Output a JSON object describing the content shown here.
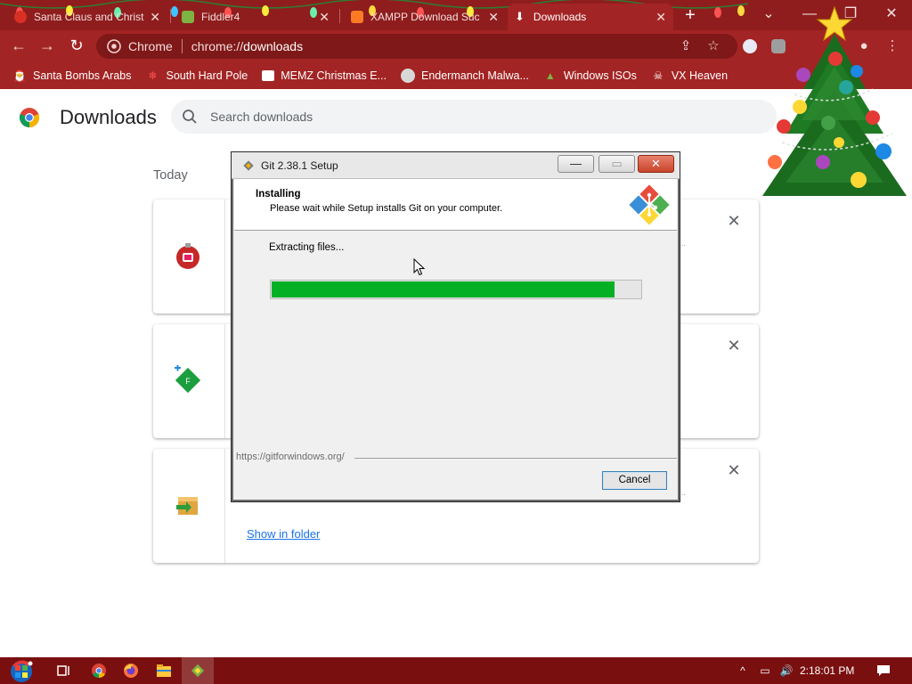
{
  "tabs": [
    {
      "title": "Santa Claus and Christ",
      "favicon_color": "#d93025",
      "active": false
    },
    {
      "title": "Fiddler4",
      "favicon_color": "#7cb342",
      "active": false
    },
    {
      "title": "XAMPP Download Suc",
      "favicon_color": "#fb7a24",
      "active": false
    },
    {
      "title": "Downloads",
      "favicon_color": "#ffffff",
      "active": true
    }
  ],
  "window_controls": {
    "minimize": "—",
    "maximize": "❐",
    "close": "✕"
  },
  "toolbar": {
    "omnibox_site": "Chrome",
    "omnibox_url_prefix": "chrome://",
    "omnibox_url_path": "downloads"
  },
  "bookmarks": [
    {
      "label": "Santa Bombs Arabs",
      "icon": "santa-icon"
    },
    {
      "label": "South Hard Pole",
      "icon": "snowflake-icon"
    },
    {
      "label": "MEMZ Christmas E...",
      "icon": "memz-icon"
    },
    {
      "label": "Endermanch Malwa...",
      "icon": "raccoon-icon"
    },
    {
      "label": "Windows ISOs",
      "icon": "tree-icon"
    },
    {
      "label": "VX Heaven",
      "icon": "skull-icon"
    }
  ],
  "downloads": {
    "title": "Downloads",
    "search_placeholder": "Search downloads",
    "date_label": "Today",
    "items": [
      {
        "icon": "ornament-icon",
        "link": ""
      },
      {
        "icon": "fiddler-icon",
        "link": ""
      },
      {
        "icon": "installer-icon",
        "link": "Show in folder"
      }
    ]
  },
  "setup": {
    "title": "Git 2.38.1 Setup",
    "heading": "Installing",
    "subheading": "Please wait while Setup installs Git on your computer.",
    "status": "Extracting files...",
    "progress_fraction": 0.93,
    "url": "https://gitforwindows.org/",
    "cancel_label": "Cancel",
    "minimize": "—",
    "maximize": "▭",
    "close": "✕"
  },
  "taskbar": {
    "clock": "2:18:01 PM",
    "apps": [
      "start-orb-icon",
      "task-view-icon",
      "chrome-icon",
      "firefox-icon",
      "file-explorer-icon",
      "git-setup-icon"
    ]
  },
  "colors": {
    "accent": "#a32424",
    "progress": "#06b025",
    "link": "#1a73e8"
  }
}
